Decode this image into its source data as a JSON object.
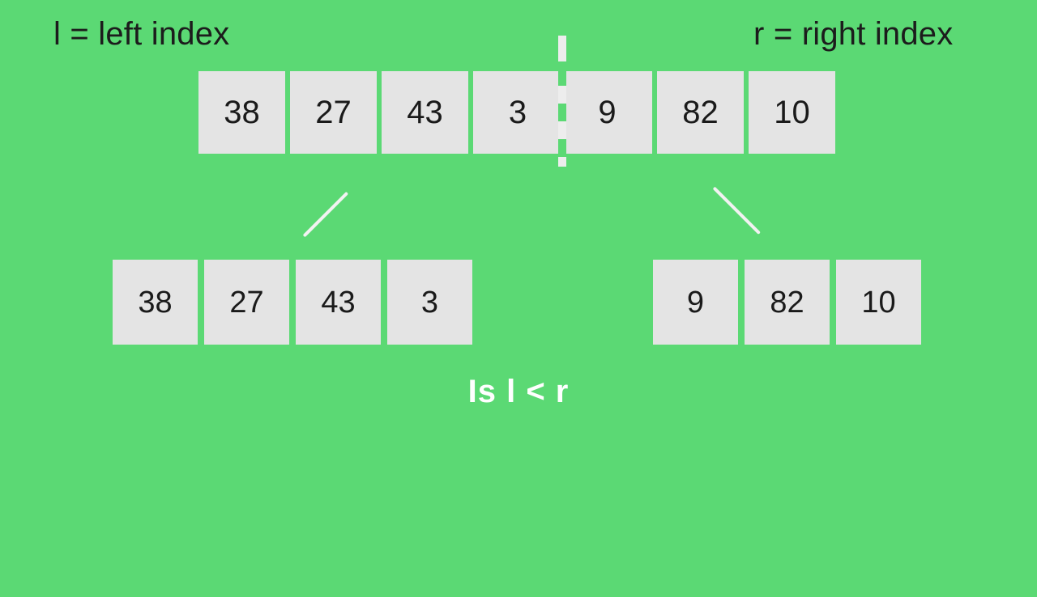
{
  "canvas": {
    "background_color": "#5BD974",
    "cell_color": "#E4E4E4",
    "cell_text_color": "#1a1a1a",
    "accent_white": "#FFFFFF"
  },
  "legend": {
    "left_label": "l = left index",
    "right_label": "r = right index"
  },
  "arrays": {
    "original": {
      "values": [
        "38",
        "27",
        "43",
        "3",
        "9",
        "82",
        "10"
      ],
      "split_after_index": 3
    },
    "left_half": {
      "values": [
        "38",
        "27",
        "43",
        "3"
      ]
    },
    "right_half": {
      "values": [
        "9",
        "82",
        "10"
      ]
    }
  },
  "condition": {
    "text": "Is l < r"
  },
  "icons": {
    "split_divider": "dashed-vertical-divider-icon",
    "branch_left": "diagonal-branch-line-icon",
    "branch_right": "diagonal-branch-line-icon"
  }
}
